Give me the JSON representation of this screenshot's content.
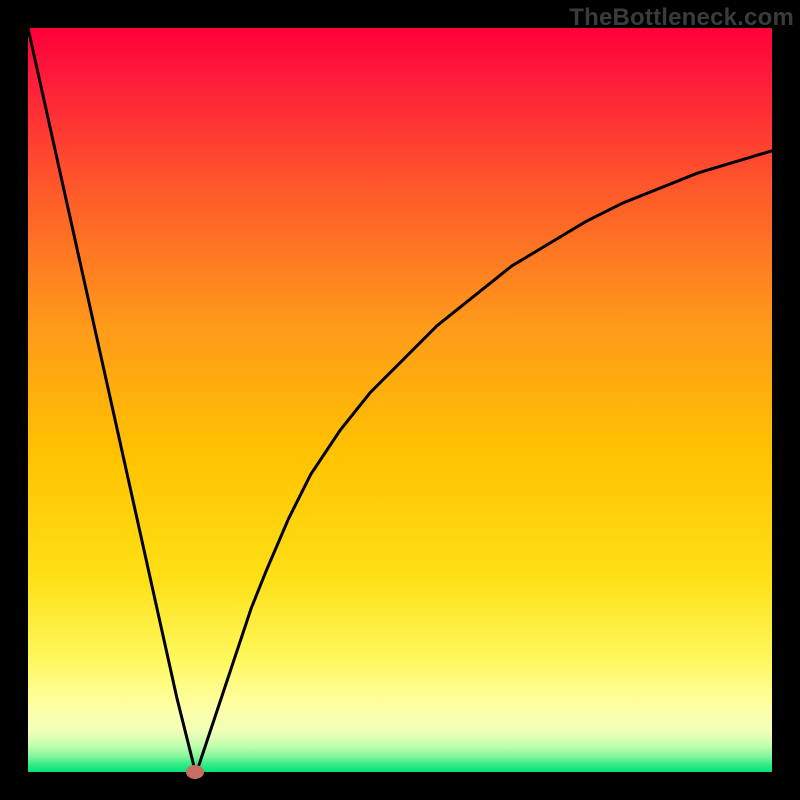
{
  "watermark": {
    "text": "TheBottleneck.com"
  },
  "chart_data": {
    "type": "line",
    "title": "",
    "xlabel": "",
    "ylabel": "",
    "xlim": [
      0,
      100
    ],
    "ylim": [
      0,
      100
    ],
    "grid": false,
    "legend": false,
    "background_gradient": {
      "top": "#ff003a",
      "upper_mid": "#ff7a1a",
      "mid": "#ffd200",
      "lower_mid": "#ffff8a",
      "bottom": "#00e27a"
    },
    "series": [
      {
        "name": "bottleneck-curve",
        "color": "#000000",
        "x": [
          0,
          2,
          4,
          6,
          8,
          10,
          12,
          14,
          16,
          18,
          20,
          22,
          22.5,
          23,
          24,
          26,
          28,
          30,
          32,
          35,
          38,
          42,
          46,
          50,
          55,
          60,
          65,
          70,
          75,
          80,
          85,
          90,
          95,
          100
        ],
        "values": [
          100,
          91,
          82,
          73,
          64,
          55,
          46,
          37,
          28,
          19,
          10,
          2,
          0,
          1,
          4,
          10,
          16,
          22,
          27,
          34,
          40,
          46,
          51,
          55,
          60,
          64,
          68,
          71,
          74,
          76.5,
          78.5,
          80.5,
          82,
          83.5
        ]
      }
    ],
    "marker": {
      "x": 22.5,
      "y": 0,
      "color": "#c76d61",
      "shape": "ellipse"
    }
  },
  "colors": {
    "frame": "#000000",
    "curve": "#000000",
    "marker": "#c76d61"
  }
}
